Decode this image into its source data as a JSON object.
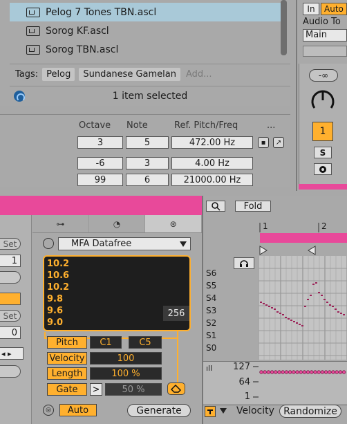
{
  "browser": {
    "files": [
      {
        "name": "Pelog 7 Tones TBN.ascl",
        "selected": true
      },
      {
        "name": "Sorog KF.ascl",
        "selected": false
      },
      {
        "name": "Sorog TBN.ascl",
        "selected": false
      }
    ],
    "tags_label": "Tags:",
    "tags": [
      "Pelog",
      "Sundanese Gamelan"
    ],
    "tags_add": "Add...",
    "status": "1 item selected"
  },
  "mixer": {
    "in_label": "In",
    "auto_label": "Auto",
    "audio_to_label": "Audio To",
    "output": "Main",
    "inf_label": "-∞",
    "track_number": "1",
    "solo_label": "S"
  },
  "tuning": {
    "headers": [
      "Octave",
      "Note",
      "Ref. Pitch/Freq",
      "..."
    ],
    "row1": {
      "octave": "3",
      "note": "5",
      "freq": "472.00 Hz"
    },
    "row2": {
      "octave": "-6",
      "note": "3",
      "freq": "4.00 Hz"
    },
    "row3": {
      "octave": "99",
      "note": "6",
      "freq": "21000.00 Hz"
    }
  },
  "left_col": {
    "set1": "Set",
    "val1": "1",
    "set2": "Set",
    "val2": "0"
  },
  "device": {
    "source_select": "MFA Datafree",
    "data_values": [
      "10.2",
      "10.6",
      "10.2",
      "9.8",
      "9.6",
      "9.0"
    ],
    "count": "256",
    "pitch_label": "Pitch",
    "pitch_from": "C1",
    "pitch_to": "C5",
    "velocity_label": "Velocity",
    "velocity_value": "100",
    "length_label": "Length",
    "length_value": "100 %",
    "gate_label": "Gate",
    "gate_op": ">",
    "gate_value": "50 %",
    "auto_label": "Auto",
    "generate_label": "Generate"
  },
  "clip": {
    "fold_label": "Fold",
    "ruler": [
      "1",
      "2"
    ],
    "keys": [
      "S6",
      "S5",
      "S4",
      "S3",
      "S2",
      "S1",
      "S0"
    ],
    "velocity_ticks": [
      "127",
      "64",
      "1"
    ],
    "velocity_label": "Velocity",
    "randomize_label": "Randomize"
  },
  "colors": {
    "accent": "#ffb02e",
    "pink": "#e8499a",
    "selected_row": "#a9c9d8"
  }
}
